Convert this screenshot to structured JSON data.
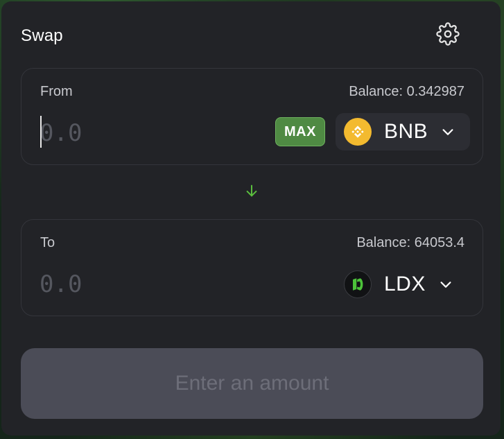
{
  "header": {
    "title": "Swap",
    "settings_icon": "gear-icon"
  },
  "from": {
    "label": "From",
    "balance": "Balance: 0.342987",
    "amount_placeholder": "0.0",
    "max_label": "MAX",
    "token": {
      "symbol": "BNB",
      "icon": "bnb-token-icon",
      "color": "#F3BA2F"
    }
  },
  "switch_icon": "arrow-down-icon",
  "to": {
    "label": "To",
    "balance": "Balance: 64053.4",
    "amount_placeholder": "0.0",
    "token": {
      "symbol": "LDX",
      "icon": "ldx-token-icon",
      "color": "#4CC23A"
    }
  },
  "submit": {
    "label": "Enter an amount",
    "enabled": false
  },
  "colors": {
    "accent_green": "#4F8A43",
    "arrow_green": "#5BBE3E",
    "card_bg": "#222327",
    "button_disabled_bg": "#4B4C57"
  }
}
